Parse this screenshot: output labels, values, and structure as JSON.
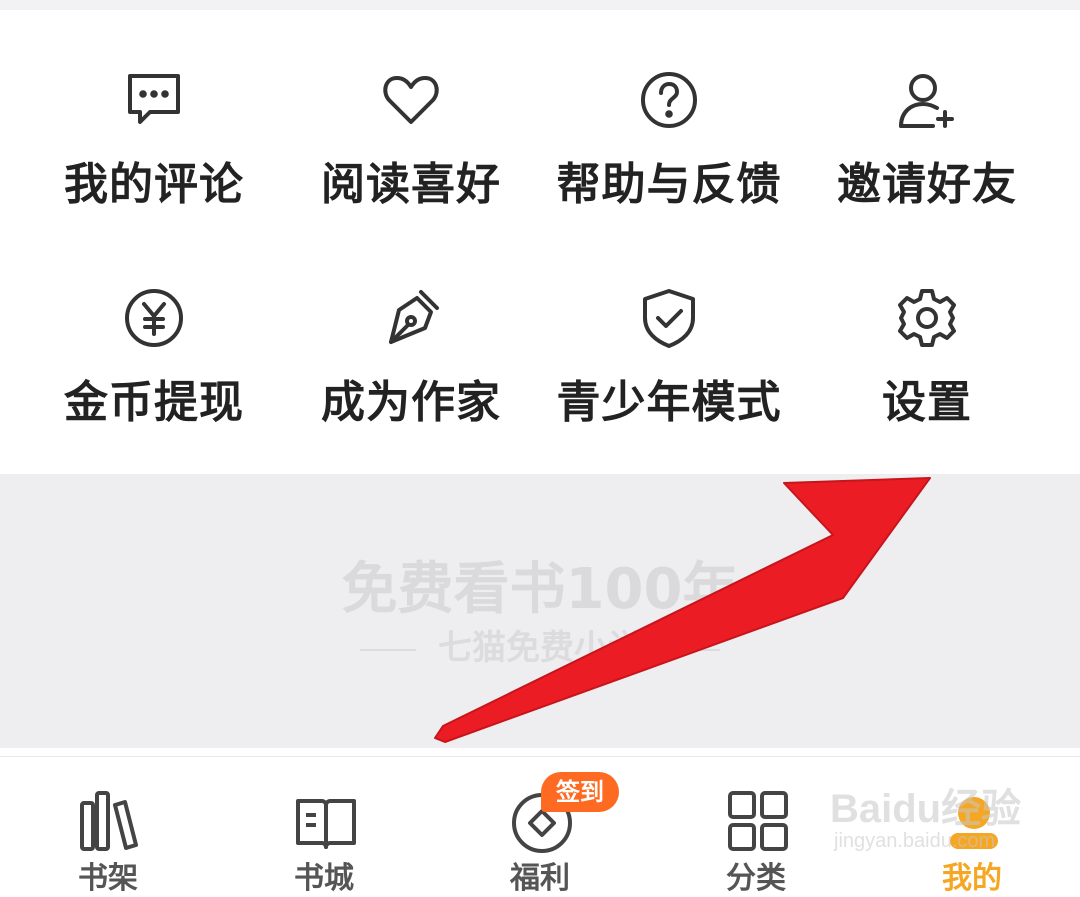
{
  "menu": {
    "items": [
      {
        "label": "我的评论",
        "icon": "comment-icon"
      },
      {
        "label": "阅读喜好",
        "icon": "heart-icon"
      },
      {
        "label": "帮助与反馈",
        "icon": "help-icon"
      },
      {
        "label": "邀请好友",
        "icon": "add-user-icon"
      },
      {
        "label": "金币提现",
        "icon": "yen-icon"
      },
      {
        "label": "成为作家",
        "icon": "pen-icon"
      },
      {
        "label": "青少年模式",
        "icon": "shield-check-icon"
      },
      {
        "label": "设置",
        "icon": "gear-icon"
      }
    ]
  },
  "banner": {
    "title": "免费看书100年",
    "subtitle": "七猫免费小说"
  },
  "tabbar": {
    "tabs": [
      {
        "label": "书架",
        "icon": "bookshelf-icon"
      },
      {
        "label": "书城",
        "icon": "book-icon"
      },
      {
        "label": "福利",
        "icon": "coin-icon"
      },
      {
        "label": "分类",
        "icon": "grid-icon"
      },
      {
        "label": "我的",
        "icon": "profile-icon",
        "active": true
      }
    ],
    "badge": "签到"
  },
  "watermark": {
    "main": "Baidu经验",
    "sub": "jingyan.baidu.com"
  },
  "colors": {
    "accent": "#f5a623",
    "badge": "#fe6a22",
    "arrow": "#ec1c24",
    "icon_stroke": "#333333"
  }
}
